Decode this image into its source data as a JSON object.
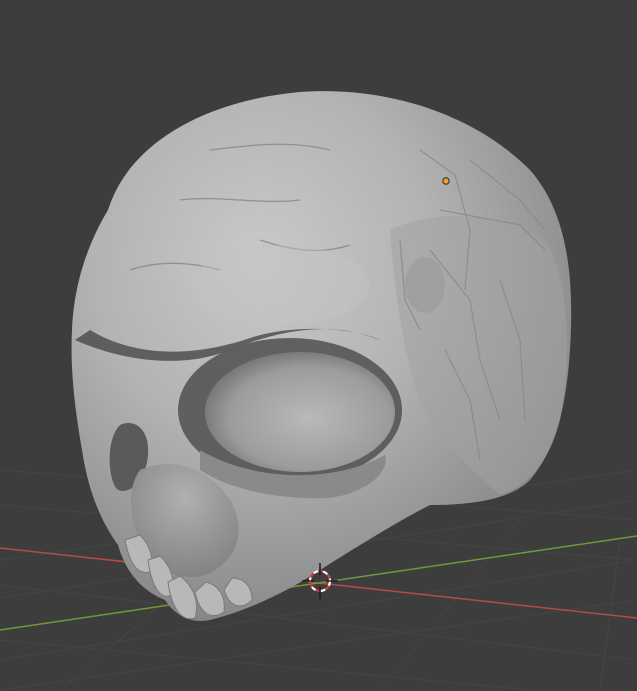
{
  "app": "Blender",
  "viewport": {
    "mode": "sculpt",
    "shading": "solid",
    "object": "skull-sculpt-mesh",
    "background_color": "#3d3d3d",
    "grid_visible": true
  },
  "axes": {
    "x_axis_color": "#b34a4a",
    "y_axis_color": "#6d9a3a"
  },
  "overlays": {
    "origin_marker_color": "#f0a030",
    "cursor_color_primary": "#d43c3c",
    "cursor_color_secondary": "#ffffff"
  },
  "icons": [
    "3d-cursor-icon",
    "origin-point-icon"
  ]
}
